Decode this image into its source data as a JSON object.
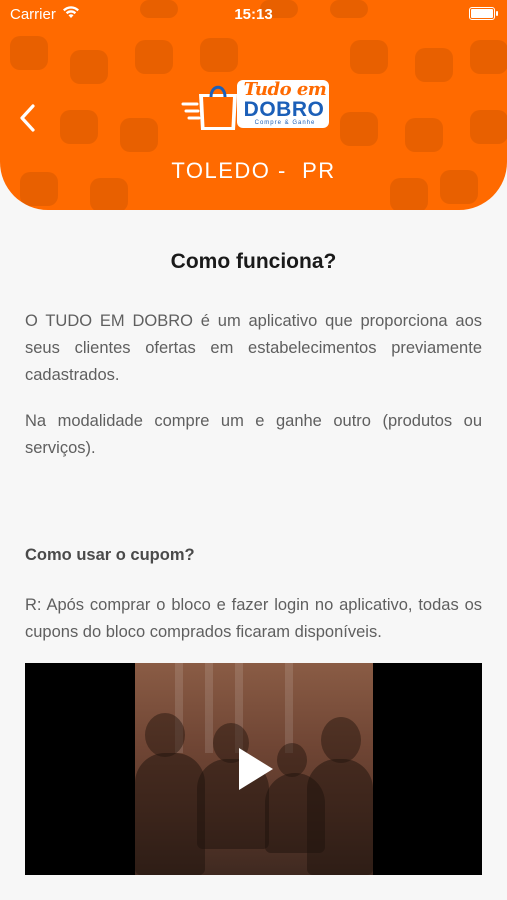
{
  "status_bar": {
    "carrier": "Carrier",
    "time": "15:13"
  },
  "header": {
    "logo": {
      "line1": "Tudo em",
      "line2": "DOBRO",
      "tagline": "Compre & Ganhe"
    },
    "city": "TOLEDO -  PR",
    "brand_color": "#ff6a00"
  },
  "main": {
    "title": "Como funciona?",
    "paragraph1": "O TUDO EM DOBRO é um aplicativo que proporciona aos seus clientes ofertas em estabelecimentos previamente cadastrados.",
    "paragraph2": "Na modalidade compre um e ganhe outro (produtos ou serviços).",
    "faq_question": "Como usar o cupom?",
    "faq_answer": "R: Após comprar o bloco e fazer login no aplicativo, todas os cupons do bloco comprados ficaram disponíveis."
  },
  "icons": {
    "back": "chevron-left-icon",
    "play": "play-icon",
    "wifi": "wifi-icon",
    "battery": "battery-icon"
  }
}
